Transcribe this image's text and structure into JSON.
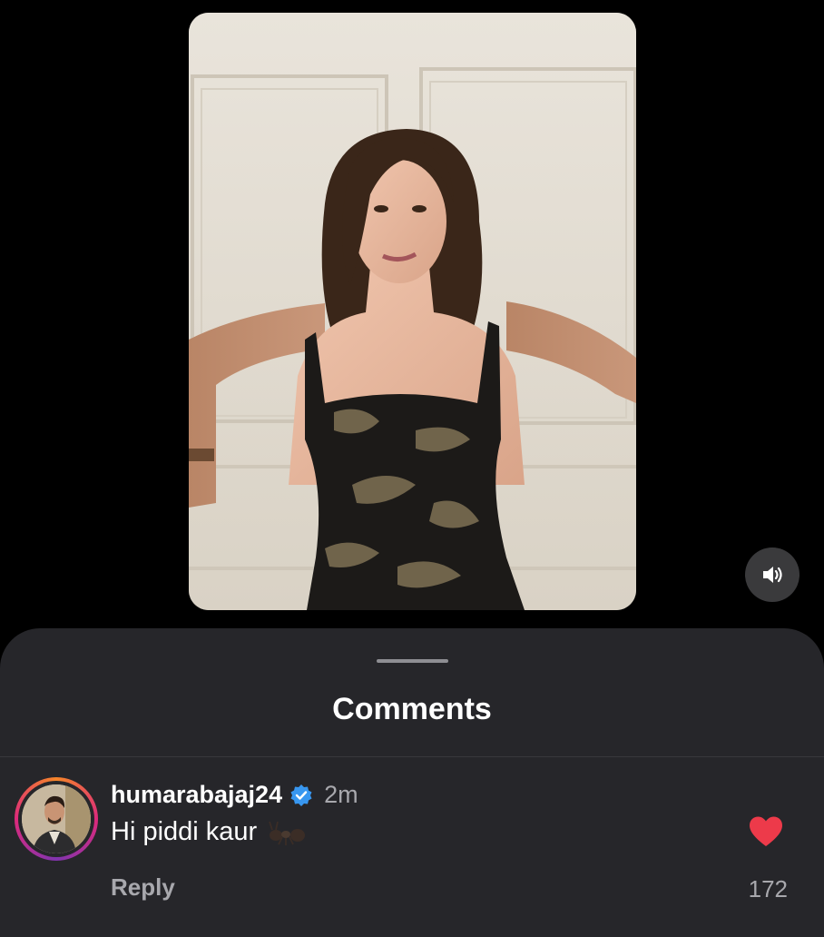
{
  "video": {
    "sound_icon": "speaker-wave-icon"
  },
  "comments_sheet": {
    "title": "Comments",
    "comment": {
      "username": "humarabajaj24",
      "verified_icon": "verified-badge-icon",
      "timestamp": "2m",
      "text": "Hi piddi kaur",
      "emoji_icon": "ant-emoji-icon",
      "reply_label": "Reply",
      "like_icon": "heart-filled-icon",
      "like_count": "172"
    }
  },
  "colors": {
    "background": "#000000",
    "sheet": "#26262a",
    "verified_blue": "#3897f0",
    "like_red": "#ed3a4a",
    "secondary_text": "#a8a8ad"
  }
}
